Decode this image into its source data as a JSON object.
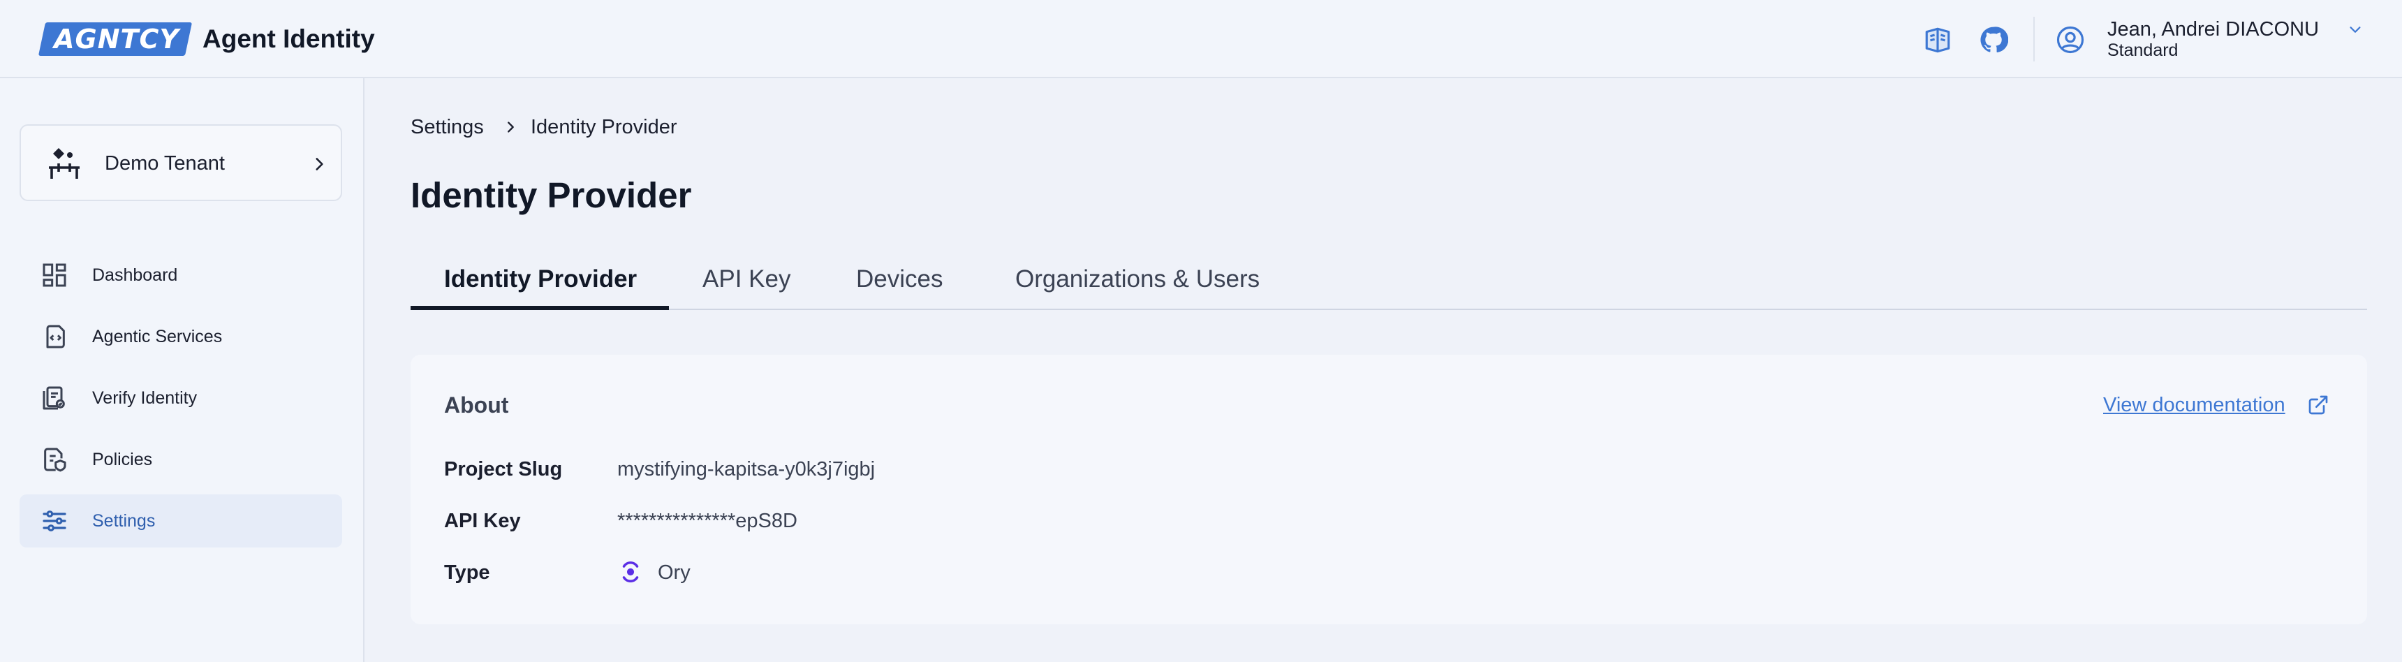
{
  "header": {
    "logo_text": "AGNTCY",
    "app_title": "Agent Identity",
    "icons": [
      "docs-book-icon",
      "github-icon",
      "user-circle-icon",
      "chevron-down-icon"
    ],
    "user_name": "Jean, Andrei DIACONU",
    "user_plan": "Standard"
  },
  "sidebar": {
    "tenant_label": "Demo Tenant",
    "items": [
      {
        "label": "Dashboard",
        "icon": "dashboard-grid-icon"
      },
      {
        "label": "Agentic Services",
        "icon": "code-file-icon"
      },
      {
        "label": "Verify Identity",
        "icon": "verify-document-icon"
      },
      {
        "label": "Policies",
        "icon": "policy-document-icon"
      },
      {
        "label": "Settings",
        "icon": "sliders-icon",
        "active": true
      }
    ]
  },
  "breadcrumb": {
    "root": "Settings",
    "current": "Identity Provider"
  },
  "page_title": "Identity Provider",
  "tabs": [
    {
      "label": "Identity Provider",
      "active": true
    },
    {
      "label": "API Key"
    },
    {
      "label": "Devices"
    },
    {
      "label": "Organizations & Users"
    }
  ],
  "card": {
    "title": "About",
    "doc_link": "View documentation",
    "rows": [
      {
        "label": "Project Slug",
        "value": "mystifying-kapitsa-y0k3j7igbj"
      },
      {
        "label": "API Key",
        "value": "***************epS8D"
      },
      {
        "label": "Type",
        "value": "Ory"
      }
    ]
  },
  "colors": {
    "accent": "#3d77d3",
    "background": "#eff2f9",
    "active_nav_bg": "#e6ecf8",
    "ory_purple": "#5b2ee6"
  }
}
